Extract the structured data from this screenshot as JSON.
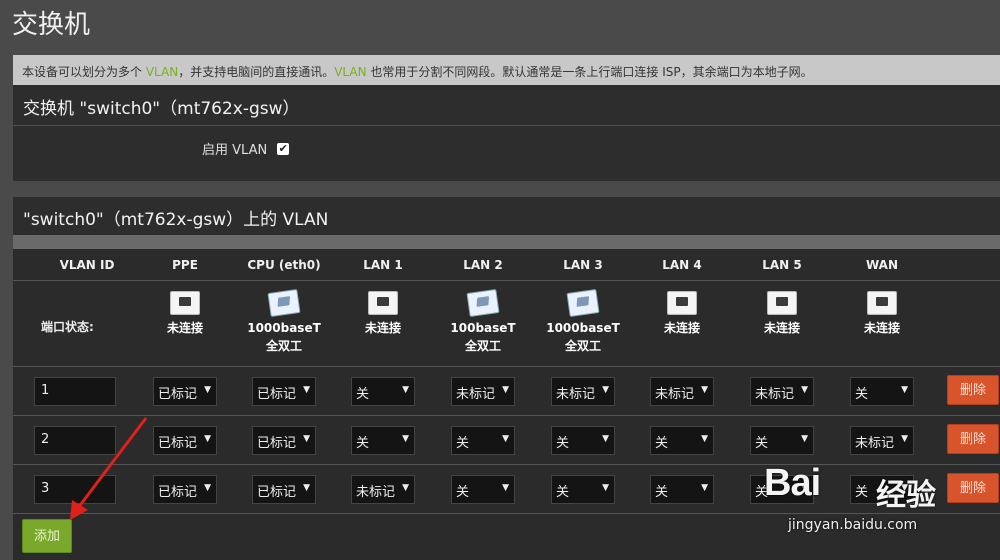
{
  "page": {
    "title": "交换机"
  },
  "description": {
    "parts": [
      {
        "text": "本设备可以划分为多个 ",
        "kw": false
      },
      {
        "text": "VLAN",
        "kw": true
      },
      {
        "text": "，并支持电脑间的直接通讯。",
        "kw": false
      },
      {
        "text": "VLAN",
        "kw": true
      },
      {
        "text": " 也常用于分割不同网段。默认通常是一条上行端口连接 ISP，其余端口为本地子网。",
        "kw": false
      }
    ]
  },
  "switch_section": {
    "title": "交换机 \"switch0\"（mt762x-gsw）",
    "enable_vlan_label": "启用 VLAN",
    "enable_vlan_checked": true,
    "checkmark": "✔"
  },
  "vlan_section": {
    "title": "\"switch0\"（mt762x-gsw）上的 VLAN",
    "columns": [
      "VLAN ID",
      "PPE",
      "CPU (eth0)",
      "LAN 1",
      "LAN 2",
      "LAN 3",
      "LAN 4",
      "LAN 5",
      "WAN"
    ],
    "port_status_label": "端口状态:",
    "port_status": [
      {
        "icon": "ethernet-port-disconnected-icon",
        "connected": false,
        "line1": "未连接",
        "line2": ""
      },
      {
        "icon": "ethernet-port-connected-icon",
        "connected": true,
        "line1": "1000baseT",
        "line2": "全双工"
      },
      {
        "icon": "ethernet-port-disconnected-icon",
        "connected": false,
        "line1": "未连接",
        "line2": ""
      },
      {
        "icon": "ethernet-port-connected-icon",
        "connected": true,
        "line1": "100baseT",
        "line2": "全双工"
      },
      {
        "icon": "ethernet-port-connected-icon",
        "connected": true,
        "line1": "1000baseT",
        "line2": "全双工"
      },
      {
        "icon": "ethernet-port-disconnected-icon",
        "connected": false,
        "line1": "未连接",
        "line2": ""
      },
      {
        "icon": "ethernet-port-disconnected-icon",
        "connected": false,
        "line1": "未连接",
        "line2": ""
      },
      {
        "icon": "ethernet-port-disconnected-icon",
        "connected": false,
        "line1": "未连接",
        "line2": ""
      }
    ],
    "rows": [
      {
        "vlan_id": "1",
        "cells": [
          "已标记",
          "已标记",
          "关",
          "未标记",
          "未标记",
          "未标记",
          "未标记",
          "关"
        ]
      },
      {
        "vlan_id": "2",
        "cells": [
          "已标记",
          "已标记",
          "关",
          "关",
          "关",
          "关",
          "关",
          "未标记"
        ]
      },
      {
        "vlan_id": "3",
        "cells": [
          "已标记",
          "已标记",
          "未标记",
          "关",
          "关",
          "关",
          "关",
          "关"
        ]
      }
    ],
    "dropdown_arrow": "▼",
    "delete_label": "删除",
    "add_label": "添加"
  },
  "watermark": {
    "brand": "Bai",
    "cn": "经验",
    "url": "jingyan.baidu.com"
  },
  "colors": {
    "accent_green": "#7aa82a",
    "delete_red": "#d9532b",
    "keyword_green": "#7bb01c"
  }
}
